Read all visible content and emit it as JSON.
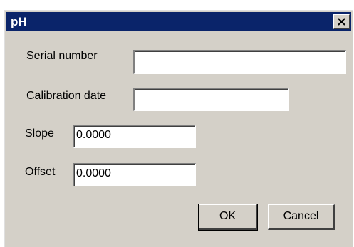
{
  "window": {
    "title": "pH",
    "title_bar_color": "#0a246a",
    "face_color": "#d4d0c8",
    "close_icon": "close-icon"
  },
  "form": {
    "serial_number": {
      "label": "Serial number",
      "value": ""
    },
    "calibration_date": {
      "label": "Calibration date",
      "value": ""
    },
    "slope": {
      "label": "Slope",
      "value": "0.0000"
    },
    "offset": {
      "label": "Offset",
      "value": "0.0000"
    }
  },
  "buttons": {
    "ok": "OK",
    "cancel": "Cancel"
  }
}
